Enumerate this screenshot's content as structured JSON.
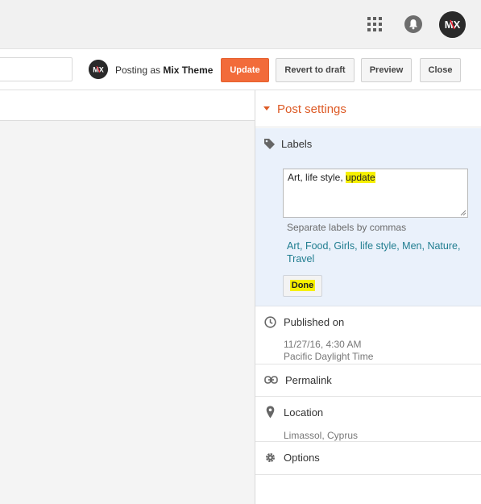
{
  "topbar": {
    "apps_icon": "apps-grid-icon",
    "notifications_icon": "bell-icon",
    "account_avatar_text": "MX"
  },
  "toolbar": {
    "posting_as_prefix": "Posting as",
    "posting_as_name": "Mix Theme",
    "update_label": "Update",
    "revert_label": "Revert to draft",
    "preview_label": "Preview",
    "close_label": "Close",
    "accent_color": "#f26b3a"
  },
  "post_settings": {
    "title": "Post settings",
    "labels": {
      "title": "Labels",
      "value_plain": "Art, life style, ",
      "value_highlight": "update",
      "hint": "Separate labels by commas",
      "suggestions": [
        "Art",
        "Food",
        "Girls",
        "life style",
        "Men",
        "Nature",
        "Travel"
      ],
      "done_label": "Done"
    },
    "published_on": {
      "title": "Published on",
      "date": "11/27/16, 4:30 AM",
      "timezone": "Pacific Daylight Time"
    },
    "permalink": {
      "title": "Permalink"
    },
    "location": {
      "title": "Location",
      "value": "Limassol, Cyprus"
    },
    "options": {
      "title": "Options"
    }
  }
}
